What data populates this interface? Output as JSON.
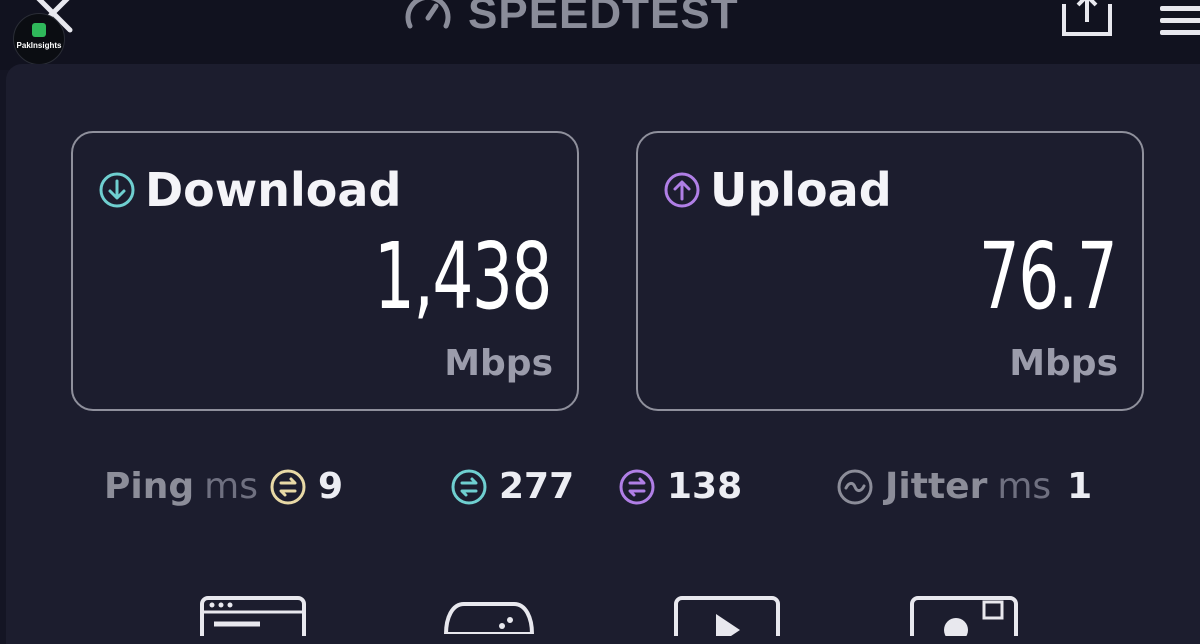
{
  "header": {
    "title": "SPEEDTEST",
    "badge_text": "PakInsights"
  },
  "download": {
    "label": "Download",
    "value": "1,438",
    "unit": "Mbps"
  },
  "upload": {
    "label": "Upload",
    "value": "76.7",
    "unit": "Mbps"
  },
  "ping": {
    "label": "Ping",
    "unit": "ms",
    "idle": "9",
    "download": "277",
    "upload": "138"
  },
  "jitter": {
    "label": "Jitter",
    "unit": "ms",
    "value": "1"
  },
  "colors": {
    "download_accent": "#6fcfd0",
    "upload_accent": "#b07fe6",
    "idle_accent": "#e8d9a6"
  },
  "bottom_nav": [
    "browser-icon",
    "gamepad-icon",
    "video-play-icon",
    "profile-card-icon"
  ]
}
